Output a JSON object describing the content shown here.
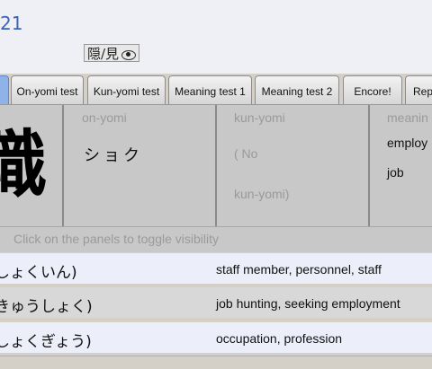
{
  "header": {
    "number": "21",
    "toggle_label": "隠/見"
  },
  "tabs": [
    {
      "label": ""
    },
    {
      "label": "On-yomi test"
    },
    {
      "label": "Kun-yomi test"
    },
    {
      "label": "Meaning test 1"
    },
    {
      "label": "Meaning test 2"
    },
    {
      "label": "Encore!"
    },
    {
      "label": "Rep"
    }
  ],
  "panels": {
    "kanji": "職",
    "onyomi": {
      "label": "on-yomi",
      "value": "ショク"
    },
    "kunyomi": {
      "label": "kun-yomi",
      "value_line1": "( No",
      "value_line2": "kun-yomi)"
    },
    "meaning": {
      "label": "meanin",
      "value_line1": "employ",
      "value_line2": "job"
    }
  },
  "hint": "Click on the panels to toggle visibility",
  "words": [
    {
      "reading": "しょくいん)",
      "meaning": "staff member, personnel, staff"
    },
    {
      "reading": "きゅうしょく)",
      "meaning": "job hunting, seeking employment"
    },
    {
      "reading": "しょくぎょう)",
      "meaning": "occupation, profession"
    }
  ]
}
